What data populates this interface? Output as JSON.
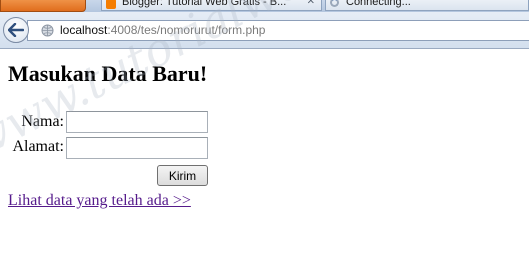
{
  "browser": {
    "tabs": [
      {
        "label": "Blogger: Tutorial Web Gratis - B...",
        "icon": "blogger-icon",
        "active": false
      },
      {
        "label": "Connecting...",
        "icon": "loading-spinner-icon",
        "active": true
      }
    ],
    "address_bar": {
      "host": "localhost",
      "path": ":4008/tes/nomorurut/form.php"
    }
  },
  "page": {
    "heading": "Masukan Data Baru!",
    "form": {
      "nama_label": "Nama:",
      "nama_value": "",
      "alamat_label": "Alamat:",
      "alamat_value": "",
      "submit_label": "Kirim"
    },
    "link_text": "Lihat data yang telah ada >>"
  },
  "watermark": "www.tutorialwebgratis.com",
  "colors": {
    "link_visited": "#551a8b",
    "chrome_blue": "#d3dfee"
  }
}
